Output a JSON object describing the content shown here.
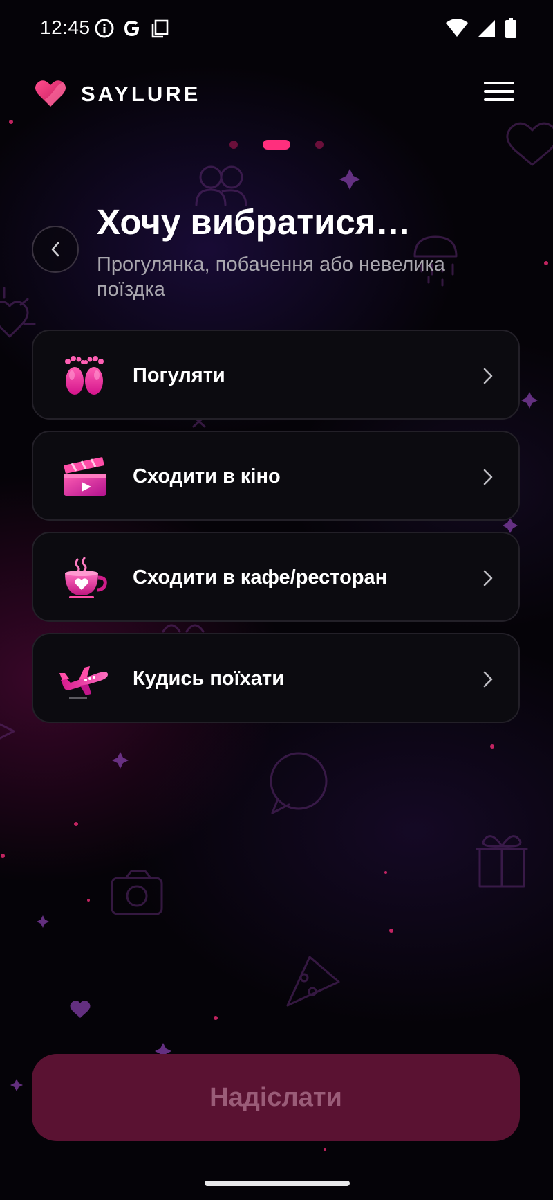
{
  "status_bar": {
    "time": "12:45",
    "left_icons": [
      "info-icon",
      "google-icon",
      "copy-icon"
    ],
    "right_icons": [
      "wifi-icon",
      "signal-icon",
      "battery-icon"
    ]
  },
  "header": {
    "logo_icon": "heart-logo-icon",
    "app_name": "SAYLURE",
    "menu_icon": "hamburger-menu-icon"
  },
  "pager": {
    "total": 3,
    "active_index": 1
  },
  "title": {
    "heading": "Хочу вибратися…",
    "subtitle": "Прогулянка, побачення або невелика поїздка",
    "back_icon": "chevron-left-icon"
  },
  "options": [
    {
      "label": "Погуляти",
      "icon": "footprints-icon"
    },
    {
      "label": "Сходити в кіно",
      "icon": "clapperboard-icon"
    },
    {
      "label": "Сходити в кафе/ресторан",
      "icon": "coffee-cup-icon"
    },
    {
      "label": "Кудись поїхати",
      "icon": "airplane-icon"
    }
  ],
  "submit": {
    "label": "Надіслати",
    "enabled": false
  },
  "colors": {
    "accent": "#ff2f7d",
    "background": "#050308",
    "card": "#0c0b10",
    "card_border": "#232028",
    "submit_disabled_bg": "#5a1232",
    "submit_disabled_text": "#9a5c78",
    "subtitle": "#a9a7ae"
  }
}
